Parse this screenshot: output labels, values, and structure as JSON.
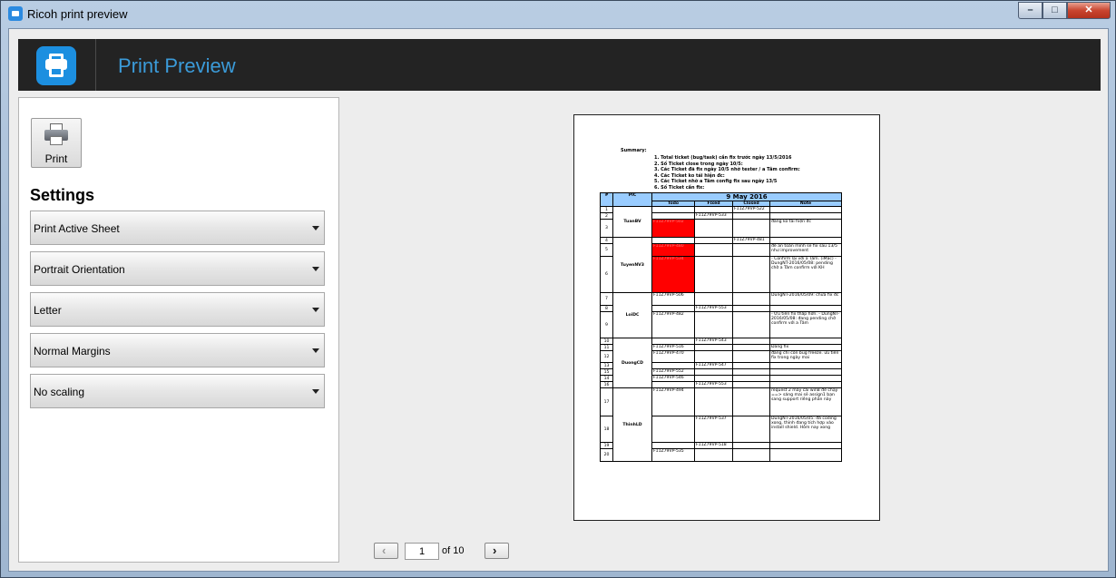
{
  "window": {
    "title": "Ricoh print preview",
    "minimize": "–",
    "maximize": "□",
    "close": "✕"
  },
  "header": {
    "title": "Print Preview",
    "logo_icon": "printer-app-icon",
    "accent": "#3b9bd9"
  },
  "left_panel": {
    "print_label": "Print",
    "settings_title": "Settings",
    "dropdowns": [
      {
        "label": "Print Active Sheet"
      },
      {
        "label": "Portrait Orientation"
      },
      {
        "label": "Letter"
      },
      {
        "label": "Normal Margins"
      },
      {
        "label": "No scaling"
      }
    ]
  },
  "pager": {
    "prev_icon": "‹",
    "next_icon": "›",
    "current_page": "1",
    "of_text": "of 10"
  },
  "sheet": {
    "summary_head": "Summary:",
    "summary_lines": [
      "1. Total ticket (bug/task) cần fix trước ngày 13/5/2016",
      "2. Số Ticket close trong ngày 10/5:",
      "3. Các Ticket đã fix ngày 10/5 nhờ tester / a Tâm confirm:",
      "4. Các Ticket ko tái hiện đc:",
      "5. Các Ticket nhờ a Tâm config fix sau ngày 13/5",
      "6. Số Ticket cần fix:"
    ],
    "headers": {
      "num": "#",
      "pic": "PIC",
      "date": "9 May 2016",
      "todo": "Todo",
      "fixed": "Fixed",
      "closed": "Closed",
      "note": "Note"
    },
    "rows": [
      {
        "n": "1",
        "pic": "TuanBV",
        "todo": "",
        "fixed": "",
        "closed": "F11Z79VP-522",
        "note": ""
      },
      {
        "n": "2",
        "todo": "",
        "fixed": "F11Z79VP-533",
        "closed": "",
        "note": ""
      },
      {
        "n": "3",
        "todo": "F11Z79VP-502",
        "red": true,
        "fixed": "",
        "closed": "",
        "note": "đang ko tái hiện đc"
      },
      {
        "n": "4",
        "pic": "TuyenNV3",
        "todo": "",
        "fixed": "",
        "closed": "F11Z79VP-481",
        "note": ""
      },
      {
        "n": "5",
        "todo": "F11Z79VP-480",
        "red": true,
        "fixed": "",
        "closed": "",
        "note": "để an toàn mình sẽ fix sau 13/5 như improvement"
      },
      {
        "n": "6",
        "todo": "F11Z79VP-534",
        "red": true,
        "fixed": "",
        "closed": "",
        "note": "- Confirm lại với a Tâm. (iMac) - DungNT-2016/05/08: pending chờ a Tâm confirm với KH"
      },
      {
        "n": "7",
        "pic": "LoiDC",
        "todo": "F11Z79VP-506",
        "fixed": "",
        "closed": "",
        "note": "DungNT-2016/05/09: chưa fix đc"
      },
      {
        "n": "8",
        "todo": "",
        "fixed": "F11Z79VP-553",
        "closed": "",
        "note": ""
      },
      {
        "n": "9",
        "todo": "F11Z79VP-482",
        "fixed": "",
        "closed": "",
        "note": "- Ưu tiên fix thấp hơn. - DungNT-2016/05/08: đang pending chờ confirm với a Tâm"
      },
      {
        "n": "10",
        "pic": "DuongCD",
        "todo": "",
        "fixed": "F11Z79VP-543",
        "closed": "",
        "note": ""
      },
      {
        "n": "11",
        "todo": "F11Z79VP-516",
        "fixed": "",
        "closed": "",
        "note": "Đang fix"
      },
      {
        "n": "12",
        "todo": "F11Z79VP-470",
        "fixed": "",
        "closed": "",
        "note": "đang chỉ còn bug freeze. ưu tiên fix trong ngày mai"
      },
      {
        "n": "13",
        "todo": "",
        "fixed": "F11Z79VP-547",
        "closed": "",
        "note": ""
      },
      {
        "n": "15",
        "todo": "F11Z79VP-552",
        "fixed": "",
        "closed": "",
        "note": ""
      },
      {
        "n": "14",
        "todo": "F11Z79VP-546",
        "fixed": "",
        "closed": "",
        "note": ""
      },
      {
        "n": "16",
        "todo": "",
        "fixed": "F11Z79VP-553",
        "closed": "",
        "note": ""
      },
      {
        "n": "17",
        "pic": "ThinhLD",
        "todo": "F11Z79VP-494",
        "fixed": "",
        "closed": "",
        "note": "request 2 máy cài win8 để chạy ==> sáng mai sẽ assign1 bạn sang support riêng phần này"
      },
      {
        "n": "18",
        "todo": "",
        "fixed": "F11Z79VP-537",
        "closed": "",
        "note": "DungNT-2016/05/05: đã coding xong, thinh đang tích hợp vào install shield. Hôm nay xong"
      },
      {
        "n": "19",
        "todo": "",
        "fixed": "F11Z79VP-518",
        "closed": "",
        "note": ""
      },
      {
        "n": "20",
        "todo": "F11Z79VP-535",
        "fixed": "",
        "closed": "",
        "note": ""
      }
    ]
  }
}
